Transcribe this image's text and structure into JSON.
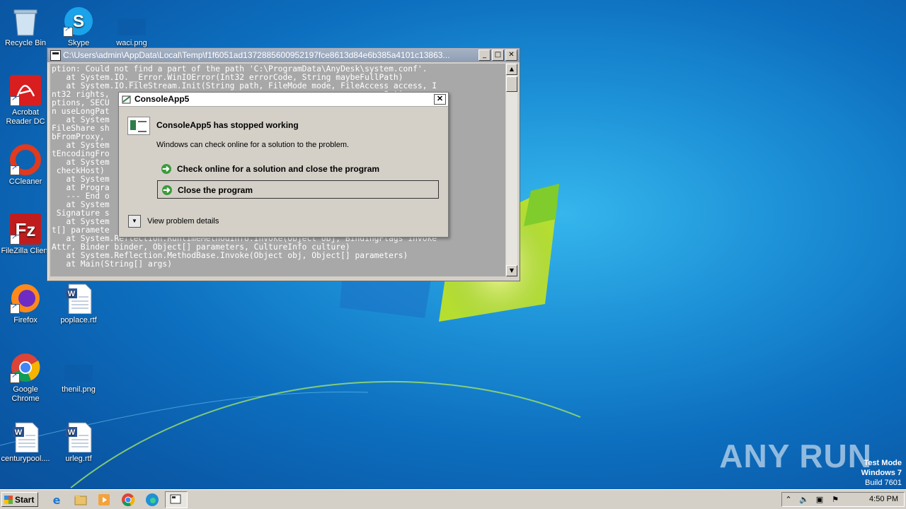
{
  "desktop": {
    "icons": [
      {
        "label": "Recycle Bin",
        "icon": "recycle-bin-icon"
      },
      {
        "label": "Skype",
        "icon": "skype-icon"
      },
      {
        "label": "waci.png",
        "icon": "image-file-icon"
      },
      {
        "label": "Acrobat Reader DC",
        "icon": "acrobat-icon"
      },
      {
        "label": "CCleaner",
        "icon": "ccleaner-icon"
      },
      {
        "label": "FileZilla Client",
        "icon": "filezilla-icon"
      },
      {
        "label": "Firefox",
        "icon": "firefox-icon"
      },
      {
        "label": "poplace.rtf",
        "icon": "word-doc-icon"
      },
      {
        "label": "Google Chrome",
        "icon": "chrome-icon"
      },
      {
        "label": "thenil.png",
        "icon": "image-file-icon"
      },
      {
        "label": "centurypool....",
        "icon": "word-doc-icon"
      },
      {
        "label": "urleg.rtf",
        "icon": "word-doc-icon"
      }
    ]
  },
  "console": {
    "title": "C:\\Users\\admin\\AppData\\Local\\Temp\\f1f6051ad1372885600952197fce8613d84e6b385a4101c13863...",
    "text": "ption: Could not find a part of the path 'C:\\ProgramData\\AnyDesk\\system.conf'.\n   at System.IO.__Error.WinIOError(Int32 errorCode, String maybeFullPath)\n   at System.IO.FileStream.Init(String path, FileMode mode, FileAccess access, I\nnt32 rights,                                                        eOptions o\nptions, SECU                                                        y, Boolea\nn useLongPat\n   at System                                                       s access,\nFileShare sh                                                        Boolean\nbFromProxy,\n   at System                                                       lean detec\ntEncodingFro\n   at System                                                       , Boolean\n checkHost)\n   at System\n   at Progra\n   --- End o\n   at System                                                       arguments,\n Signature s\n   at System                                                       obj, Objec\nt[] paramete\n   at System.Reflection.RuntimeMethodInfo.Invoke(Object obj, BindingFlags invoke\nAttr, Binder binder, Object[] parameters, CultureInfo culture)\n   at System.Reflection.MethodBase.Invoke(Object obj, Object[] parameters)\n   at Main(String[] args)",
    "buttons": {
      "minimize": "_",
      "maximize": "□",
      "close": "✕"
    }
  },
  "dialog": {
    "title": "ConsoleApp5",
    "heading": "ConsoleApp5 has stopped working",
    "subtext": "Windows can check online for a solution to the problem.",
    "option1": "Check online for a solution and close the program",
    "option2": "Close the program",
    "details": "View problem details",
    "close": "✕"
  },
  "taskbar": {
    "start": "Start",
    "clock": "4:50 PM",
    "pinned": [
      "ie-icon",
      "explorer-icon",
      "media-player-icon",
      "chrome-icon",
      "edge-icon",
      "console-window-icon"
    ]
  },
  "watermark": "ANY RUN",
  "testmode": {
    "line1": "Test Mode",
    "line2": "Windows 7",
    "line3": "Build 7601"
  }
}
